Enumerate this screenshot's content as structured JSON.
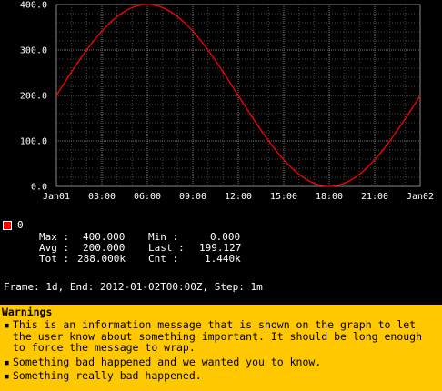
{
  "chart_data": {
    "type": "line",
    "x_tick_labels": [
      "Jan01",
      "03:00",
      "06:00",
      "09:00",
      "12:00",
      "15:00",
      "18:00",
      "21:00",
      "Jan02"
    ],
    "y_tick_labels": [
      "0.0",
      "100.0",
      "200.0",
      "300.0",
      "400.0"
    ],
    "y_ticks": [
      0,
      100,
      200,
      300,
      400
    ],
    "ylim": [
      0,
      400
    ],
    "xlim_hours": [
      0,
      24
    ],
    "grid": true,
    "series": [
      {
        "name": "0",
        "color": "#ff0000",
        "x_hours": [
          0,
          1,
          2,
          3,
          4,
          5,
          6,
          7,
          8,
          9,
          10,
          11,
          12,
          13,
          14,
          15,
          16,
          17,
          18,
          19,
          20,
          21,
          22,
          23,
          24
        ],
        "values": [
          200.0,
          251.8,
          300.0,
          341.4,
          373.2,
          393.2,
          400.0,
          393.2,
          373.2,
          341.4,
          300.0,
          251.8,
          200.0,
          148.2,
          100.0,
          58.6,
          26.8,
          6.8,
          0.0,
          6.8,
          26.8,
          58.6,
          100.0,
          148.2,
          199.1
        ]
      }
    ]
  },
  "legend": {
    "series_name": "0",
    "max_label": "Max :",
    "max_value": "400.000",
    "min_label": "Min :",
    "min_value": "0.000",
    "avg_label": "Avg :",
    "avg_value": "200.000",
    "last_label": "Last :",
    "last_value": "199.127",
    "tot_label": "Tot :",
    "tot_value": "288.000k",
    "cnt_label": "Cnt :",
    "cnt_value": "1.440k"
  },
  "frame_info": "Frame: 1d, End: 2012-01-02T00:00Z, Step: 1m",
  "warnings": {
    "title": "Warnings",
    "bullet": "▪",
    "items": [
      "This is an information message that is shown on the graph to let the user know about something important. It should be long enough to force the message to wrap.",
      "Something bad happened and we wanted you to know.",
      "Something really bad happened."
    ]
  }
}
